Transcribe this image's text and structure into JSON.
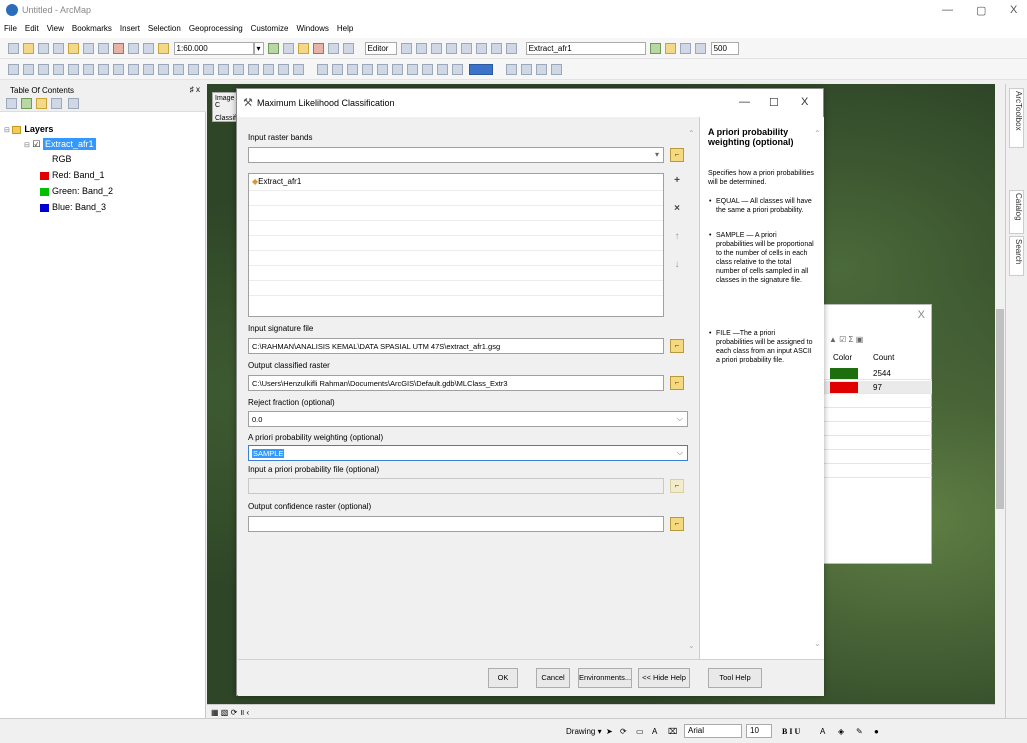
{
  "app": {
    "title": "Untitled - ArcMap",
    "window_controls": [
      "—",
      "▢",
      "X"
    ]
  },
  "menu": [
    "File",
    "Edit",
    "View",
    "Bookmarks",
    "Insert",
    "Selection",
    "Geoprocessing",
    "Customize",
    "Windows",
    "Help"
  ],
  "toolbar": {
    "scale": "1:60.000",
    "editor_label": "Editor",
    "layer_select": "Extract_afr1",
    "zoom_value": "500"
  },
  "toc": {
    "title": "Table Of Contents",
    "pin": "♯ x",
    "layers_label": "Layers",
    "layer_name": "Extract_afr1",
    "rgb_label": "RGB",
    "bands": [
      {
        "label": "Red:  Band_1",
        "color": "#e00000"
      },
      {
        "label": "Green: Band_2",
        "color": "#00c000"
      },
      {
        "label": "Blue:  Band_3",
        "color": "#0000d0"
      }
    ]
  },
  "behind_window": {
    "tab1": "Image C",
    "tab2": "Classifi"
  },
  "attr_table": {
    "columns": [
      "Color",
      "Count"
    ],
    "rows": [
      {
        "color": "#1f6e0e",
        "count": "2544"
      },
      {
        "color": "#e00000",
        "count": "97"
      }
    ],
    "toolbar_icons": "▲ ☑ Σ ▣"
  },
  "dialog": {
    "title": "Maximum Likelihood Classification",
    "controls": [
      "—",
      "☐",
      "X"
    ],
    "input_raster_label": "Input raster bands",
    "raster_list": [
      "Extract_afr1"
    ],
    "signature_label": "Input signature file",
    "signature_value": "C:\\RAHMAN\\ANALISIS KEMAL\\DATA SPASIAL UTM 47S\\extract_afr1.gsg",
    "output_label": "Output classified raster",
    "output_value": "C:\\Users\\Henzulkifli Rahman\\Documents\\ArcGIS\\Default.gdb\\MLClass_Extr3",
    "reject_label": "Reject fraction (optional)",
    "reject_value": "0.0",
    "apriori_label": "A priori probability weighting (optional)",
    "apriori_value": "SAMPLE",
    "apriori_file_label": "Input a priori probability file (optional)",
    "confidence_label": "Output confidence raster (optional)",
    "buttons": {
      "ok": "OK",
      "cancel": "Cancel",
      "env": "Environments...",
      "hide": "<< Hide Help",
      "toolhelp": "Tool Help"
    }
  },
  "help": {
    "heading": "A priori probability weighting (optional)",
    "intro": "Specifies how a priori probabilities will be determined.",
    "items": [
      "EQUAL — All classes will have the same a priori probability.",
      "SAMPLE — A priori probabilities will be proportional to the number of cells in each class relative to the total number of cells sampled in all classes in the signature file.",
      "FILE —The a priori probabilities will be assigned to each class from an input ASCII a priori probability file."
    ]
  },
  "right_dock": [
    "ArcToolbox",
    "Catalog",
    "Search"
  ],
  "drawbar": {
    "drawing": "Drawing ▾",
    "font": "Arial",
    "size": "10",
    "style": "B  I  U"
  },
  "map_status": "▦ ▧ ⟳ ॥ ‹"
}
